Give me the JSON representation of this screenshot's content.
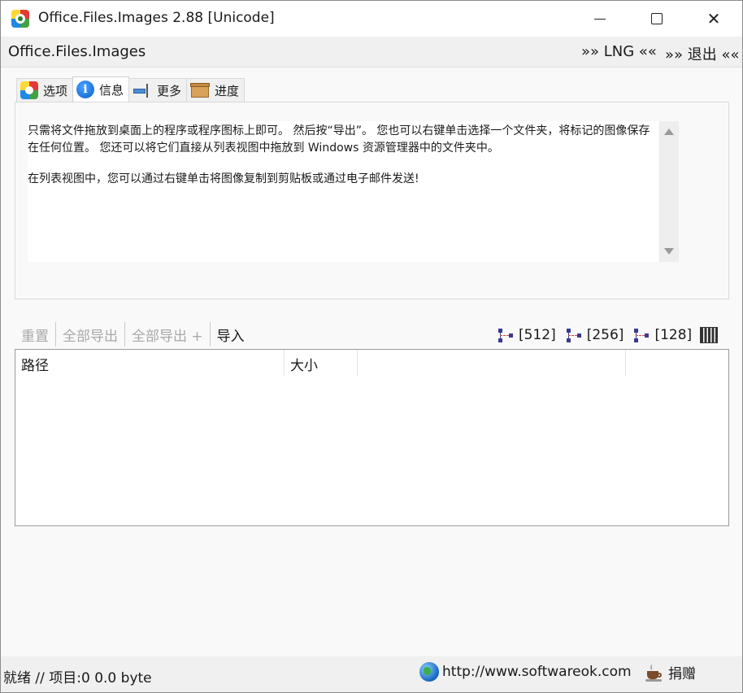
{
  "window": {
    "title": "Office.Files.Images 2.88 [Unicode]",
    "close_glyph": "✕"
  },
  "menubar": {
    "app_name": "Office.Files.Images",
    "lng": "»» LNG ««",
    "exit": "»» 退出 ««"
  },
  "tabs": [
    {
      "label": "选项",
      "icon": "options-icon",
      "active": false
    },
    {
      "label": "信息",
      "icon": "info-icon",
      "active": true
    },
    {
      "label": "更多",
      "icon": "more-icon",
      "active": false
    },
    {
      "label": "进度",
      "icon": "progress-icon",
      "active": false
    }
  ],
  "info": {
    "icon_glyph": "i",
    "paragraph1": "只需将文件拖放到桌面上的程序或程序图标上即可。 然后按“导出”。 您也可以右键单击选择一个文件夹，将标记的图像保存在任何位置。 您还可以将它们直接从列表视图中拖放到 Windows 资源管理器中的文件夹中。",
    "paragraph2": "在列表视图中，您可以通过右键单击将图像复制到剪贴板或通过电子邮件发送!"
  },
  "toolbar": {
    "reset": "重置",
    "export_all": "全部导出",
    "export_all_plus": "全部导出 +",
    "import": "导入",
    "size_512": "[512]",
    "size_256": "[256]",
    "size_128": "[128]"
  },
  "list": {
    "columns": [
      "路径",
      "大小",
      ""
    ]
  },
  "status": {
    "text": "就绪 // 项目:0 0.0 byte",
    "url": "http://www.softwareok.com",
    "donate": "捐赠"
  }
}
